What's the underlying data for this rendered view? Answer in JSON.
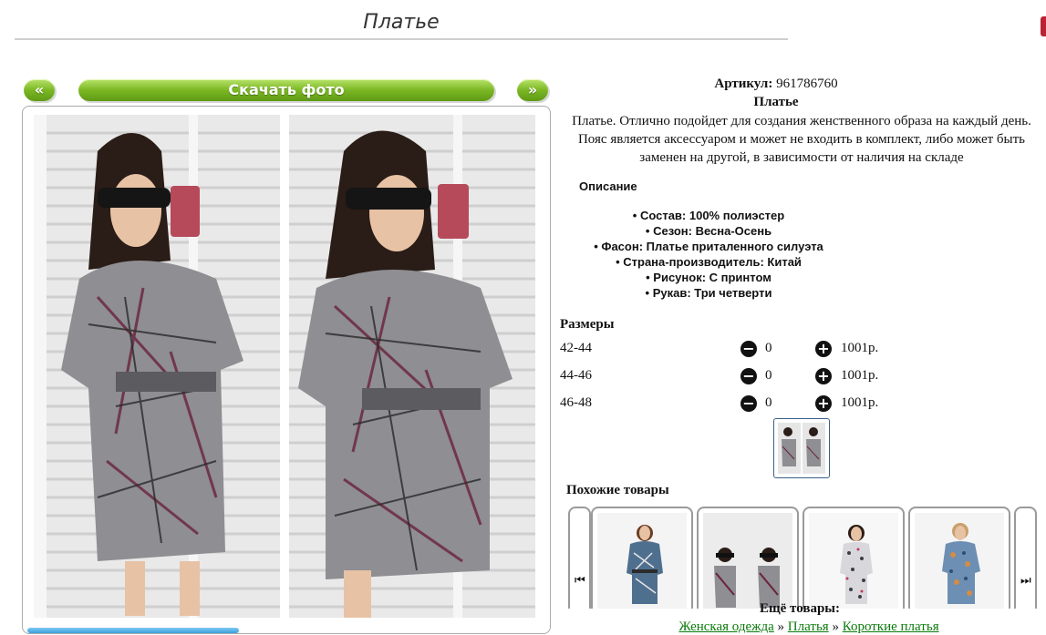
{
  "page": {
    "title": "Платье"
  },
  "gallery": {
    "prev_label": "«",
    "download_label": "Скачать фото",
    "next_label": "»"
  },
  "product": {
    "sku_label": "Артикул:",
    "sku": "961786760",
    "name": "Платье",
    "description": "Платье. Отлично подойдет для создания женственного образа на каждый день. Пояс является аксессуаром и может не входить в комплект, либо может быть заменен на другой, в зависимости от наличия на складе"
  },
  "specs": {
    "heading": "Описание",
    "items": [
      "Состав: 100% полиэстер",
      "Сезон: Весна-Осень",
      "Фасон: Платье приталенного силуэта",
      "Страна-производитель: Китай",
      "Рисунок: С принтом",
      "Рукав: Три четверти"
    ]
  },
  "sizes": {
    "heading": "Размеры",
    "rows": [
      {
        "size": "42-44",
        "qty": "0",
        "price": "1001р."
      },
      {
        "size": "44-46",
        "qty": "0",
        "price": "1001р."
      },
      {
        "size": "46-48",
        "qty": "0",
        "price": "1001р."
      }
    ]
  },
  "similar": {
    "heading": "Похожие товары"
  },
  "more": {
    "heading": "Ещё товары:",
    "crumbs": [
      "Женская одежда",
      "Платья",
      "Короткие платья"
    ],
    "separator": "»"
  },
  "colors": {
    "button_green": "#7bb724",
    "link_green": "#0a7a0a",
    "frame_border": "#aaaaaa"
  }
}
